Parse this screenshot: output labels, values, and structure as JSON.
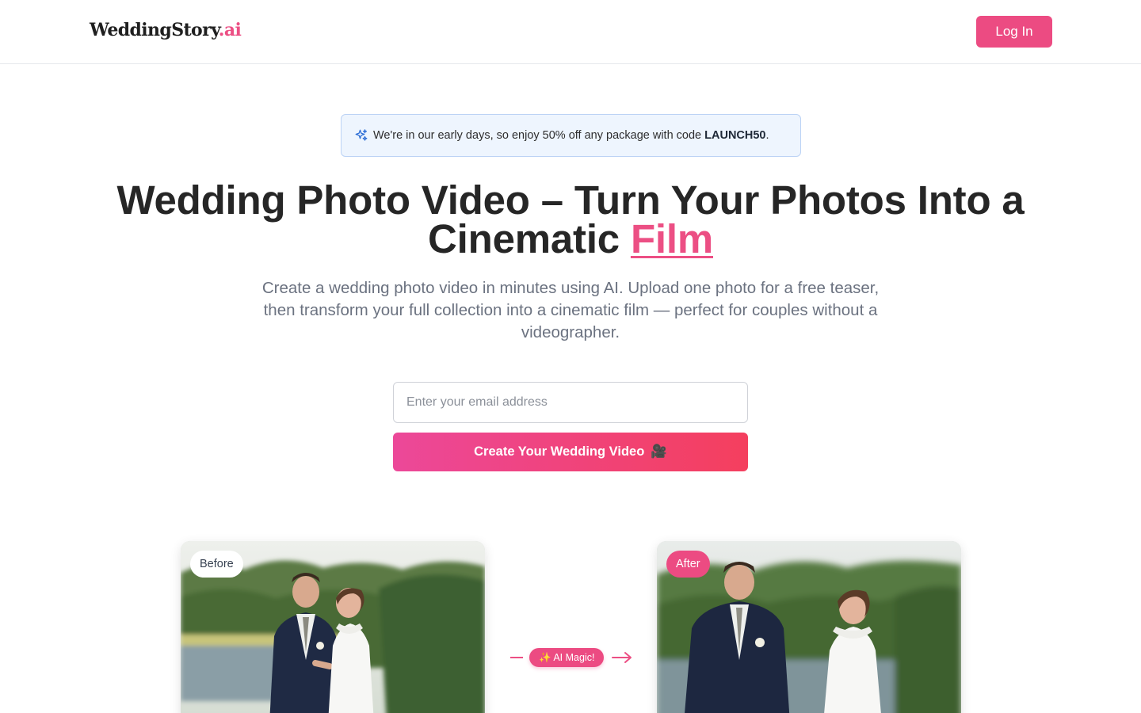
{
  "header": {
    "logo_main": "WeddingStory",
    "logo_suffix": ".ai",
    "login_label": "Log In"
  },
  "promo": {
    "icon": "sparkles-icon",
    "text": "We're in our early days, so enjoy 50% off any package with code ",
    "code": "LAUNCH50",
    "suffix": "."
  },
  "hero": {
    "title_part1": "Wedding Photo Video – Turn Your Photos Into a Cinematic ",
    "title_accent": "Film",
    "subtitle": "Create a wedding photo video in minutes using AI. Upload one photo for a free teaser, then transform your full collection into a cinematic film — perfect for couples without a videographer."
  },
  "form": {
    "email_placeholder": "Enter your email address",
    "email_value": "",
    "cta_label": "Create Your Wedding Video",
    "cta_icon": "🎥"
  },
  "comparison": {
    "before_label": "Before",
    "after_label": "After",
    "magic_label": "✨ AI Magic!"
  },
  "colors": {
    "brand_pink": "#ec4b82",
    "promo_bg": "#eef5fe",
    "promo_border": "#bcd3f5"
  }
}
